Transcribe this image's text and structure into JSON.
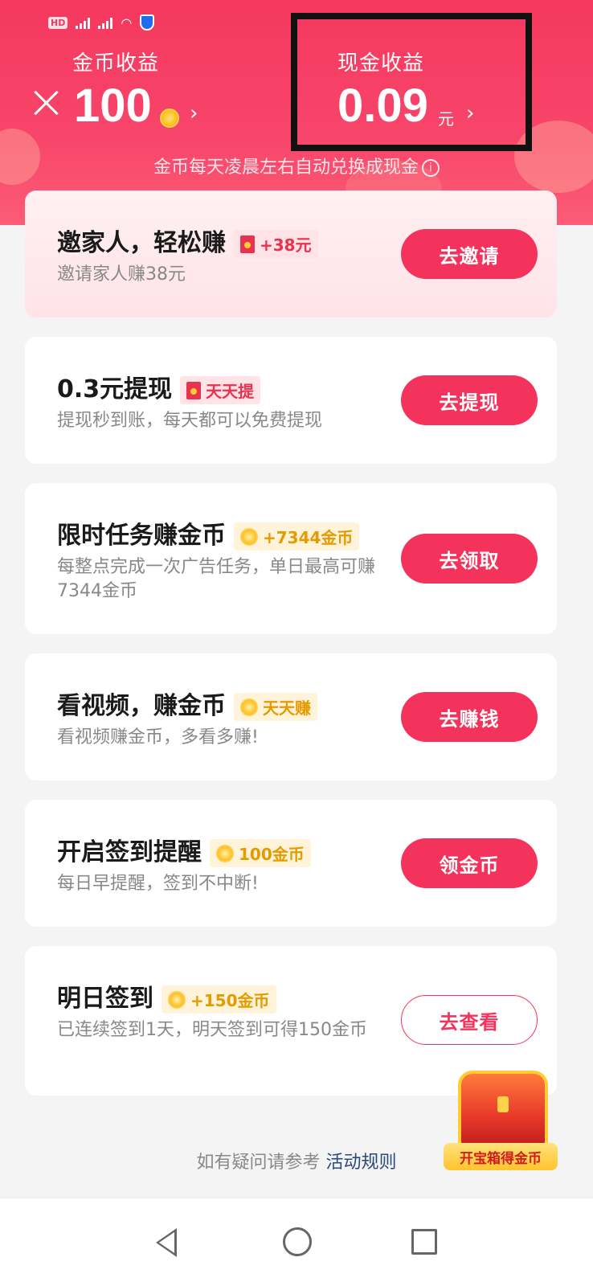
{
  "header": {
    "coin_label": "金币收益",
    "coin_value": "100",
    "cash_label": "现金收益",
    "cash_value": "0.09",
    "cash_unit": "元",
    "note": "金币每天凌晨左右自动兑换成现金",
    "chevron": "›",
    "info_glyph": "i"
  },
  "tasks": [
    {
      "title": "邀家人，轻松赚",
      "badge": "+38元",
      "badge_style": "red",
      "desc": "邀请家人赚38元",
      "button": "去邀请"
    },
    {
      "title": "0.3元提现",
      "badge": "天天提",
      "badge_style": "red",
      "desc": "提现秒到账，每天都可以免费提现",
      "button": "去提现"
    },
    {
      "title": "限时任务赚金币",
      "badge": "+7344金币",
      "badge_style": "gold",
      "desc": "每整点完成一次广告任务，单日最高可赚7344金币",
      "button": "去领取"
    },
    {
      "title": "看视频，赚金币",
      "badge": "天天赚",
      "badge_style": "gold",
      "desc": "看视频赚金币，多看多赚!",
      "button": "去赚钱"
    },
    {
      "title": "开启签到提醒",
      "badge": "100金币",
      "badge_style": "gold",
      "desc": "每日早提醒，签到不中断!",
      "button": "领金币"
    },
    {
      "title": "明日签到",
      "badge": "+150金币",
      "badge_style": "gold",
      "desc": "已连续签到1天，明天签到可得150金币",
      "button": "去查看"
    }
  ],
  "footer": {
    "note": "如有疑问请参考",
    "link": "活动规则"
  },
  "chest": {
    "label": "开宝箱得金币"
  },
  "icons": [
    "close-icon",
    "coin-icon",
    "chevron-right-icon",
    "info-icon",
    "red-envelope-icon",
    "treasure-chest-icon",
    "back-icon",
    "home-icon",
    "recent-apps-icon"
  ],
  "colors": {
    "primary": "#f4335c",
    "gold": "#e59a00",
    "header": "#f4385e"
  }
}
